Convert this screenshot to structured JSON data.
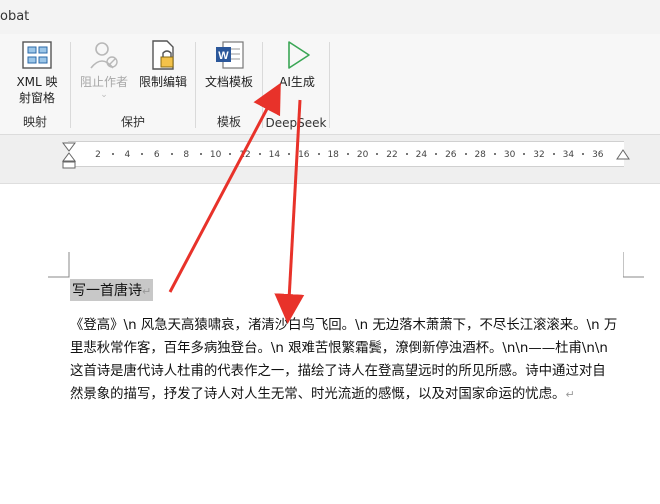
{
  "window": {
    "title": "obat"
  },
  "ribbon": {
    "groups": [
      {
        "label": "映射",
        "buttons": [
          {
            "label_line1": "XML 映",
            "label_line2": "射窗格",
            "icon": "xml-mapping-icon"
          }
        ]
      },
      {
        "label": "保护",
        "buttons": [
          {
            "label_line1": "阻止作者",
            "icon": "block-author-icon",
            "disabled": true
          },
          {
            "label_line1": "限制编辑",
            "icon": "restrict-editing-icon"
          }
        ]
      },
      {
        "label": "模板",
        "buttons": [
          {
            "label_line1": "文档模板",
            "icon": "word-template-icon"
          }
        ]
      },
      {
        "label": "DeepSeek",
        "buttons": [
          {
            "label_line1": "AI生成",
            "icon": "play-icon"
          }
        ]
      }
    ]
  },
  "ruler": {
    "ticks": [
      "2",
      "4",
      "6",
      "8",
      "10",
      "12",
      "14",
      "16",
      "18",
      "20",
      "22",
      "24",
      "26",
      "28",
      "30",
      "32",
      "34",
      "36"
    ]
  },
  "document": {
    "heading": "写一首唐诗",
    "body": "《登高》\\n 风急天高猿啸哀，渚清沙白鸟飞回。\\n 无边落木萧萧下，不尽长江滚滚来。\\n 万里悲秋常作客，百年多病独登台。\\n 艰难苦恨繁霜鬓，潦倒新停浊酒杯。\\n\\n——杜甫\\n\\n 这首诗是唐代诗人杜甫的代表作之一，描绘了诗人在登高望远时的所见所感。诗中通过对自然景象的描写，抒发了诗人对人生无常、时光流逝的感慨，以及对国家命运的忧虑。",
    "paragraph_mark": "↵"
  },
  "colors": {
    "arrow": "#e8322a",
    "word_blue": "#2b579a",
    "play_green": "#3aa655"
  }
}
